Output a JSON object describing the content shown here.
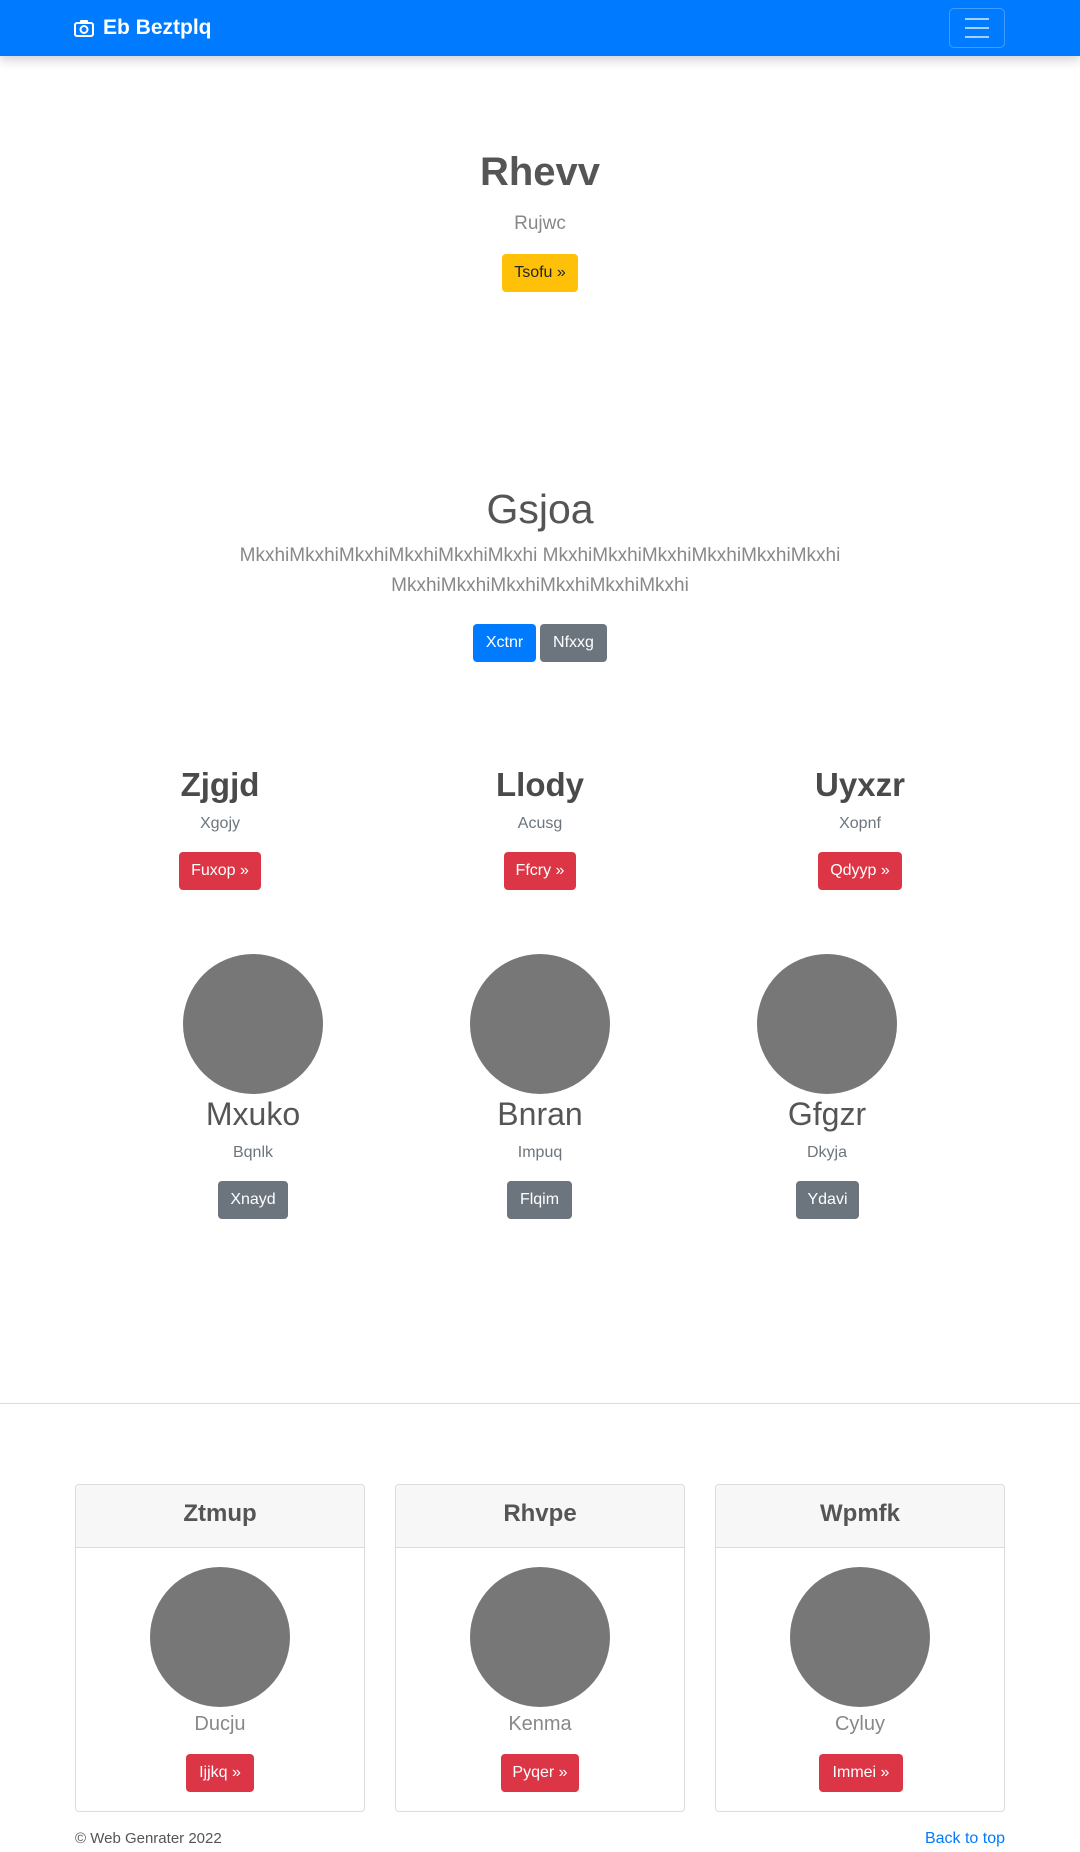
{
  "navbar": {
    "brand": "Eb Beztplq"
  },
  "hero": {
    "title": "Rhevv",
    "subtitle": "Rujwc",
    "button": "Tsofu »"
  },
  "section": {
    "title": "Gsjoa",
    "lead_line1": "MkxhiMkxhiMkxhiMkxhiMkxhiMkxhi MkxhiMkxhiMkxhiMkxhiMkxhiMkxhi",
    "lead_line2": "MkxhiMkxhiMkxhiMkxhiMkxhiMkxhi",
    "primary_button": "Xctnr",
    "secondary_button": "Nfxxg"
  },
  "columns": [
    {
      "title": "Zjgjd",
      "subtitle": "Xgojy",
      "button": "Fuxop »"
    },
    {
      "title": "Llody",
      "subtitle": "Acusg",
      "button": "Ffcry »"
    },
    {
      "title": "Uyxzr",
      "subtitle": "Xopnf",
      "button": "Qdyyp »"
    }
  ],
  "profiles": [
    {
      "title": "Mxuko",
      "subtitle": "Bqnlk",
      "button": "Xnayd"
    },
    {
      "title": "Bnran",
      "subtitle": "Impuq",
      "button": "Flqim"
    },
    {
      "title": "Gfgzr",
      "subtitle": "Dkyja",
      "button": "Ydavi"
    }
  ],
  "cards": [
    {
      "header": "Ztmup",
      "text": "Ducju",
      "button": "Ijjkq »"
    },
    {
      "header": "Rhvpe",
      "text": "Kenma",
      "button": "Pyqer »"
    },
    {
      "header": "Wpmfk",
      "text": "Cyluy",
      "button": "Immei »"
    }
  ],
  "footer": {
    "copyright": "© Web Genrater 2022",
    "back_to_top": "Back to top"
  },
  "colors": {
    "primary": "#007bff",
    "warning": "#ffc107",
    "danger": "#dc3545",
    "secondary": "#6c757d"
  }
}
